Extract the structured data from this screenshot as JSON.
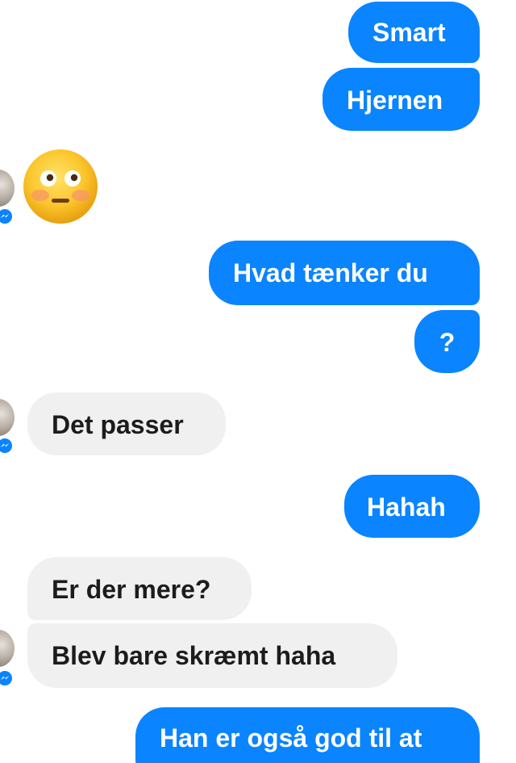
{
  "conversation": {
    "messages": [
      {
        "from": "me",
        "text": "Smart"
      },
      {
        "from": "me",
        "text": "Hjernen"
      },
      {
        "from": "them",
        "emoji": "flushed-face"
      },
      {
        "from": "me",
        "text": "Hvad tænker du"
      },
      {
        "from": "me",
        "text": "?"
      },
      {
        "from": "them",
        "text": "Det passer"
      },
      {
        "from": "me",
        "text": "Hahah"
      },
      {
        "from": "them",
        "text": "Er der mere?"
      },
      {
        "from": "them",
        "text": "Blev bare skræmt haha"
      },
      {
        "from": "me",
        "text": "Han er også god til at"
      }
    ]
  },
  "colors": {
    "outgoing_bubble": "#0a84ff",
    "incoming_bubble": "#f0f0f0",
    "outgoing_text": "#ffffff",
    "incoming_text": "#1c1c1c",
    "messenger_badge": "#0a84ff"
  },
  "icons": {
    "avatar": "contact-avatar",
    "badge": "messenger-badge-icon",
    "emoji": "flushed-face-emoji"
  }
}
